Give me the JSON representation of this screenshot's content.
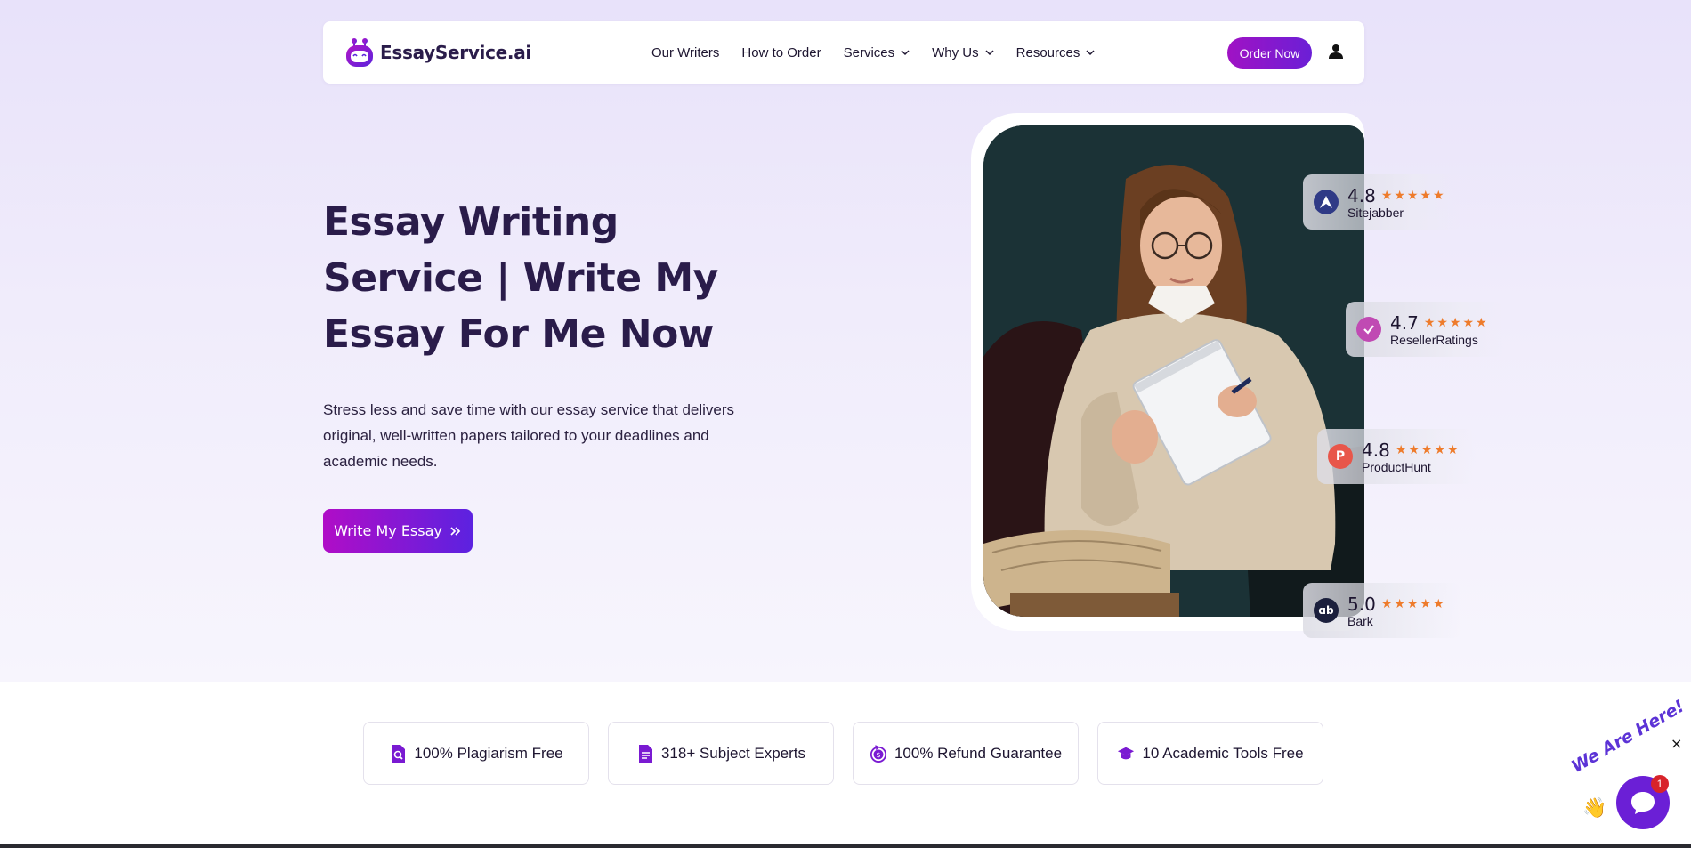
{
  "brand": {
    "name": "EssayService.ai",
    "accent": "#7a1ad2"
  },
  "nav": {
    "links": [
      "Our Writers",
      "How to Order",
      "Services",
      "Why Us",
      "Resources"
    ],
    "order_label": "Order Now"
  },
  "hero": {
    "title": "Essay Writing Service | Write My Essay For Me Now",
    "description": "Stress less and save time with our essay service that delivers original, well-written papers tailored to your deadlines and academic needs.",
    "cta_label": "Write My Essay"
  },
  "ratings": [
    {
      "score": "4.8",
      "stars": "★★★★★",
      "name": "Sitejabber",
      "icon": "sitejabber-icon",
      "color": "#2f3a86"
    },
    {
      "score": "4.7",
      "stars": "★★★★★",
      "name": "ResellerRatings",
      "icon": "resellerratings-icon",
      "color": "#c04ab3"
    },
    {
      "score": "4.8",
      "stars": "★★★★★",
      "name": "ProductHunt",
      "icon": "producthunt-icon",
      "color": "#e8564a"
    },
    {
      "score": "5.0",
      "stars": "★★★★★",
      "name": "Bark",
      "icon": "bark-icon",
      "color": "#1b1f3c"
    }
  ],
  "features": [
    {
      "label": "100% Plagiarism Free",
      "icon": "plagiarism-check-icon"
    },
    {
      "label": "318+ Subject Experts",
      "icon": "document-icon"
    },
    {
      "label": "100% Refund Guarantee",
      "icon": "refund-icon"
    },
    {
      "label": "10 Academic Tools Free",
      "icon": "graduation-cap-icon"
    }
  ],
  "chat": {
    "tag": "We Are Here!",
    "badge_count": "1",
    "close": "×"
  }
}
